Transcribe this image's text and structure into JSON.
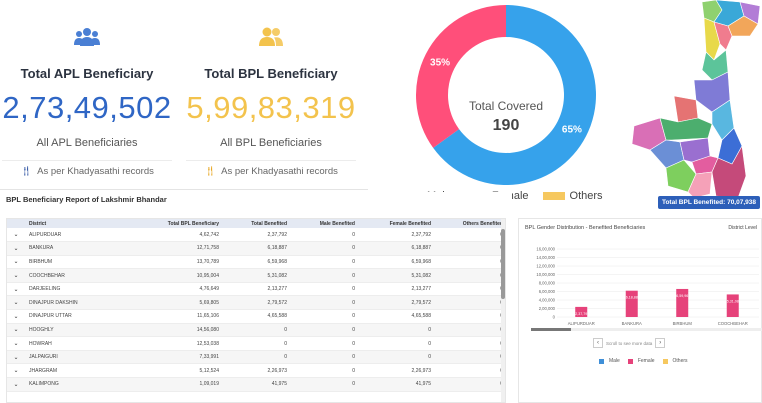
{
  "kpi": {
    "apl": {
      "title": "Total APL Beneficiary",
      "value": "2,73,49,502",
      "sub": "All APL Beneficiaries",
      "note": "As per Khadyasathi records"
    },
    "bpl": {
      "title": "Total BPL Beneficiary",
      "value": "5,99,83,319",
      "sub": "All BPL Beneficiaries",
      "note": "As per Khadyasathi records"
    }
  },
  "donut": {
    "center_label": "Total Covered",
    "center_value": "190",
    "slices": [
      {
        "name": "Male",
        "value": 65,
        "label": "65%",
        "color": "#36a2eb"
      },
      {
        "name": "Female",
        "value": 35,
        "label": "35%",
        "color": "#ff4f7a"
      }
    ],
    "legend": [
      {
        "name": "Male",
        "color": "#36a2eb"
      },
      {
        "name": "Female",
        "color": "#ff4f7a"
      },
      {
        "name": "Others",
        "color": "#f6c85f"
      }
    ]
  },
  "map": {
    "badge": "Total BPL Benefited: 70,07,938"
  },
  "table": {
    "title": "BPL Beneficiary Report of Lakshmir Bhandar",
    "columns": [
      "District",
      "Total BPL Beneficiary",
      "Total Benefited",
      "Male Benefited",
      "Female Benefited",
      "Others Benefited"
    ],
    "rows": [
      [
        "ALIPURDUAR",
        "4,62,742",
        "2,37,792",
        "0",
        "2,37,792",
        "0"
      ],
      [
        "BANKURA",
        "12,71,758",
        "6,18,887",
        "0",
        "6,18,887",
        "0"
      ],
      [
        "BIRBHUM",
        "13,70,789",
        "6,59,968",
        "0",
        "6,59,968",
        "0"
      ],
      [
        "COOCHBEHAR",
        "10,95,004",
        "5,31,082",
        "0",
        "5,31,082",
        "0"
      ],
      [
        "DARJEELING",
        "4,76,649",
        "2,13,277",
        "0",
        "2,13,277",
        "0"
      ],
      [
        "DINAJPUR DAKSHIN",
        "5,69,805",
        "2,79,572",
        "0",
        "2,79,572",
        "0"
      ],
      [
        "DINAJPUR UTTAR",
        "11,65,106",
        "4,65,588",
        "0",
        "4,65,588",
        "0"
      ],
      [
        "HOOGHLY",
        "14,56,080",
        "0",
        "0",
        "0",
        "0"
      ],
      [
        "HOWRAH",
        "12,53,038",
        "0",
        "0",
        "0",
        "0"
      ],
      [
        "JALPAIGURI",
        "7,33,991",
        "0",
        "0",
        "0",
        "0"
      ],
      [
        "JHARGRAM",
        "5,12,524",
        "2,26,973",
        "0",
        "2,26,973",
        "0"
      ],
      [
        "KALIMPONG",
        "1,09,019",
        "41,975",
        "0",
        "41,975",
        "0"
      ]
    ]
  },
  "gender_chart": {
    "title": "BPL Gender Distribution - Benefited Beneficiaries",
    "level": "District Level",
    "pager_text": "Scroll to see more data",
    "legend": [
      {
        "name": "Male",
        "color": "#3f8fd8"
      },
      {
        "name": "Female",
        "color": "#e6427a"
      },
      {
        "name": "Others",
        "color": "#f6c85f"
      }
    ]
  },
  "chart_data": {
    "type": "bar",
    "title": "BPL Gender Distribution - Benefited Beneficiaries",
    "categories": [
      "ALIPURDUAR",
      "BANKURA",
      "BIRBHUM",
      "COOCHBEHAR"
    ],
    "series": [
      {
        "name": "Male",
        "values": [
          0,
          0,
          0,
          0
        ]
      },
      {
        "name": "Female",
        "values": [
          237792,
          618887,
          659968,
          531082
        ]
      },
      {
        "name": "Others",
        "values": [
          0,
          0,
          0,
          0
        ]
      }
    ],
    "bar_labels": [
      "2,37,79",
      "6,18,88",
      "6,59,96",
      "5,31,08"
    ],
    "yticks": [
      "0",
      "2,00,000",
      "4,00,000",
      "6,00,000",
      "8,00,000",
      "10,00,000",
      "12,00,000",
      "14,00,000",
      "16,00,000"
    ],
    "ylim": [
      0,
      1600000
    ],
    "xlabel": "",
    "ylabel": "",
    "grid": true
  }
}
